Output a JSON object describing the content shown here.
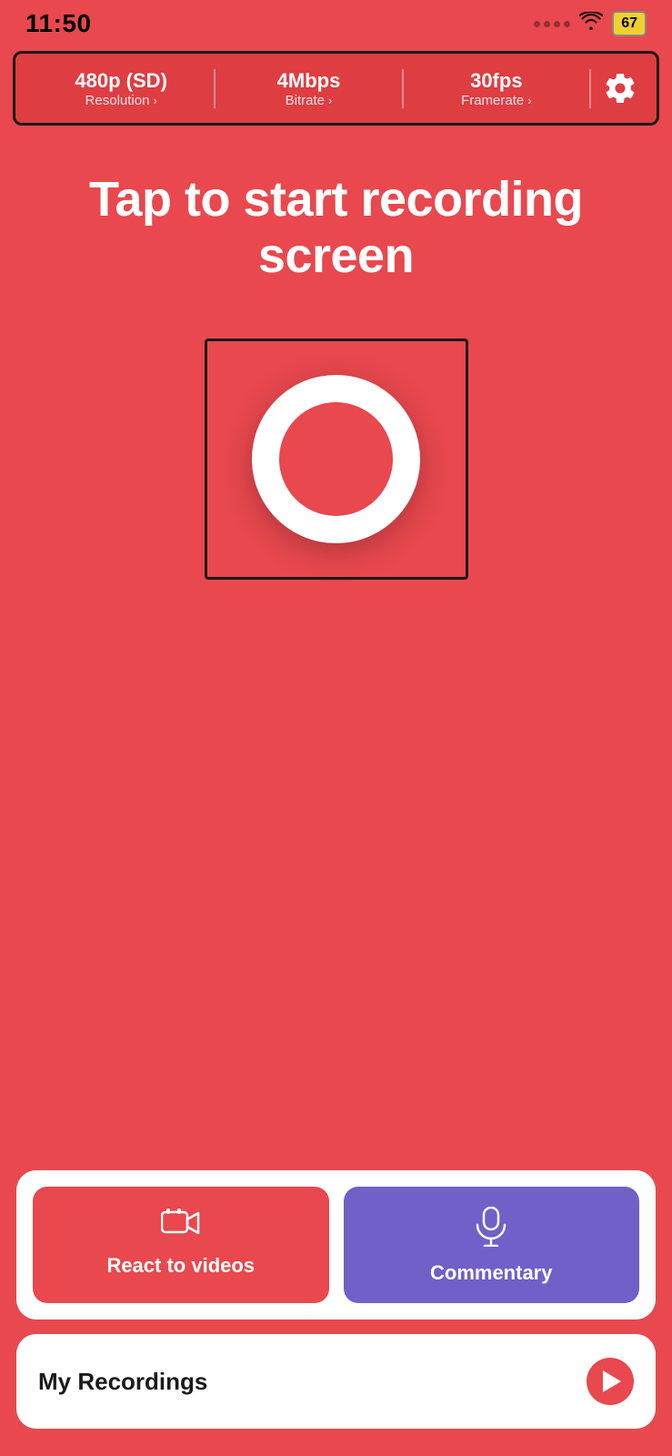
{
  "statusBar": {
    "time": "11:50",
    "battery": "67"
  },
  "settingsBar": {
    "resolution": {
      "value": "480p (SD)",
      "label": "Resolution"
    },
    "bitrate": {
      "value": "4Mbps",
      "label": "Bitrate"
    },
    "framerate": {
      "value": "30fps",
      "label": "Framerate"
    }
  },
  "mainTitle": "Tap to start recording screen",
  "actions": {
    "reactVideos": {
      "label": "React to videos"
    },
    "commentary": {
      "label": "Commentary"
    }
  },
  "recordings": {
    "label": "My Recordings"
  }
}
